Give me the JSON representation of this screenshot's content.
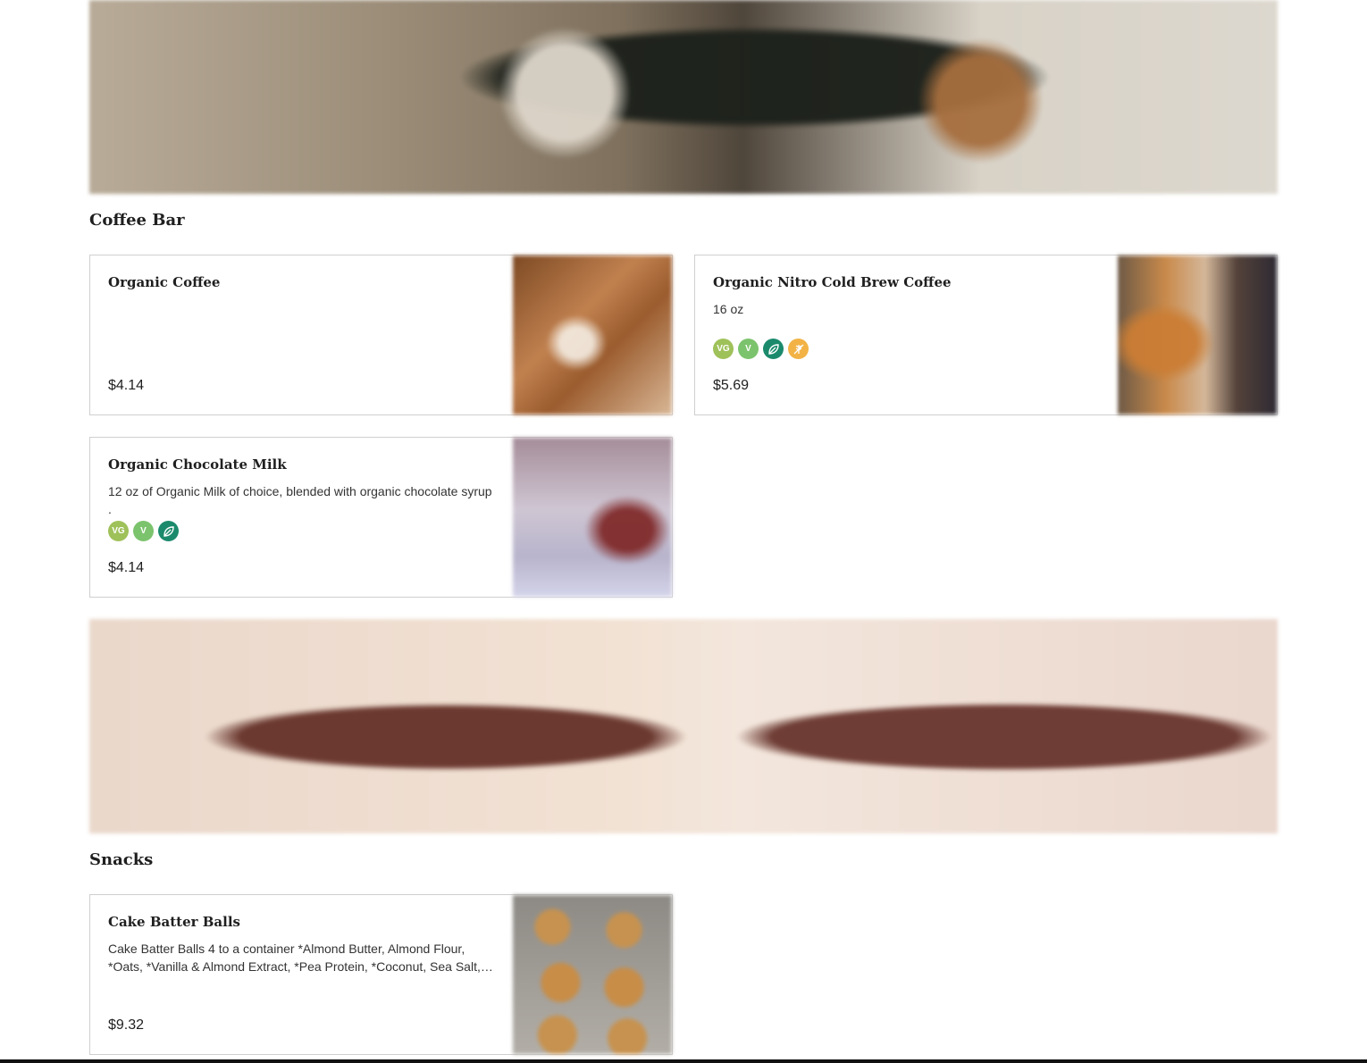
{
  "sections": [
    {
      "title": "Coffee Bar",
      "items": [
        {
          "name": "Organic Coffee",
          "description": "",
          "price": "$4.14",
          "badges": []
        },
        {
          "name": "Organic Nitro Cold Brew Coffee",
          "description": "16 oz",
          "price": "$5.69",
          "badges": [
            "VG",
            "V",
            "leaf-icon",
            "gluten-free-icon"
          ]
        },
        {
          "name": "Organic Chocolate Milk",
          "description": "12 oz of Organic Milk of choice, blended with organic chocolate syrup .",
          "price": "$4.14",
          "badges": [
            "VG",
            "V",
            "leaf-icon"
          ]
        }
      ]
    },
    {
      "title": "Snacks",
      "items": [
        {
          "name": "Cake Batter Balls",
          "description": "Cake Batter Balls 4 to a container *Almond Butter, Almond Flour, *Oats, *Vanilla & Almond Extract, *Pea Protein, *Coconut, Sea Salt,…",
          "price": "$9.32",
          "badges": []
        }
      ]
    }
  ],
  "colors": {
    "badge_vg": "#9fc15a",
    "badge_v": "#7cc36d",
    "badge_leaf": "#1b8a6c",
    "badge_gluten_free": "#f2b245",
    "card_border": "#cfcfcf"
  }
}
